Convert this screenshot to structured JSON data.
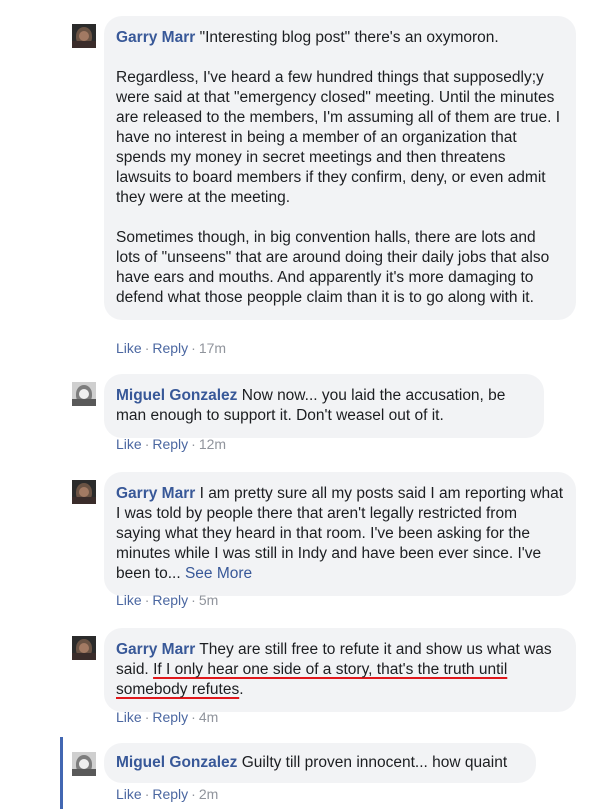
{
  "comments": [
    {
      "author": "Garry Marr",
      "p1": "\"Interesting blog post\" there's an oxymoron.",
      "p2": "Regardless, I've heard a few hundred things that supposedly;y were said at that \"emergency closed\" meeting. Until the minutes are released to the members, I'm assuming all of them are true. I have no interest in being a member of an organization that spends my money in secret meetings and then threatens lawsuits to board members if they confirm, deny, or even admit they were at the meeting.",
      "p3": "Sometimes though, in big convention halls, there are lots and lots of \"unseens\" that are around doing their daily jobs that also have ears and mouths. And apparently it's more damaging to defend what those peopple claim than it is to go along with it.",
      "like": "Like",
      "reply": "Reply",
      "time": "17m"
    },
    {
      "author": "Miguel Gonzalez",
      "text": "Now now... you laid the accusation, be man enough to support it. Don't weasel out of it.",
      "like": "Like",
      "reply": "Reply",
      "time": "12m"
    },
    {
      "author": "Garry Marr",
      "text": "I am pretty sure all my posts said I am reporting what I was told by people there that aren't legally restricted from saying what they heard in that room. I've been asking for the minutes while I was still in Indy and have been ever since. I've been to...",
      "see_more": "See More",
      "like": "Like",
      "reply": "Reply",
      "time": "5m"
    },
    {
      "author": "Garry Marr",
      "text": "They are still free to refute it and show us what was said.",
      "underlined": "If I only hear one side of a story, that's the truth until somebody refutes",
      "after": ".",
      "like": "Like",
      "reply": "Reply",
      "time": "4m"
    },
    {
      "author": "Miguel Gonzalez",
      "text": "Guilty till proven innocent... how quaint",
      "like": "Like",
      "reply": "Reply",
      "time": "2m"
    }
  ],
  "separator": "·",
  "colors": {
    "author": "#385898",
    "bubble": "#f2f3f5",
    "underline": "#e0181c",
    "thread_line": "#4267b2"
  }
}
